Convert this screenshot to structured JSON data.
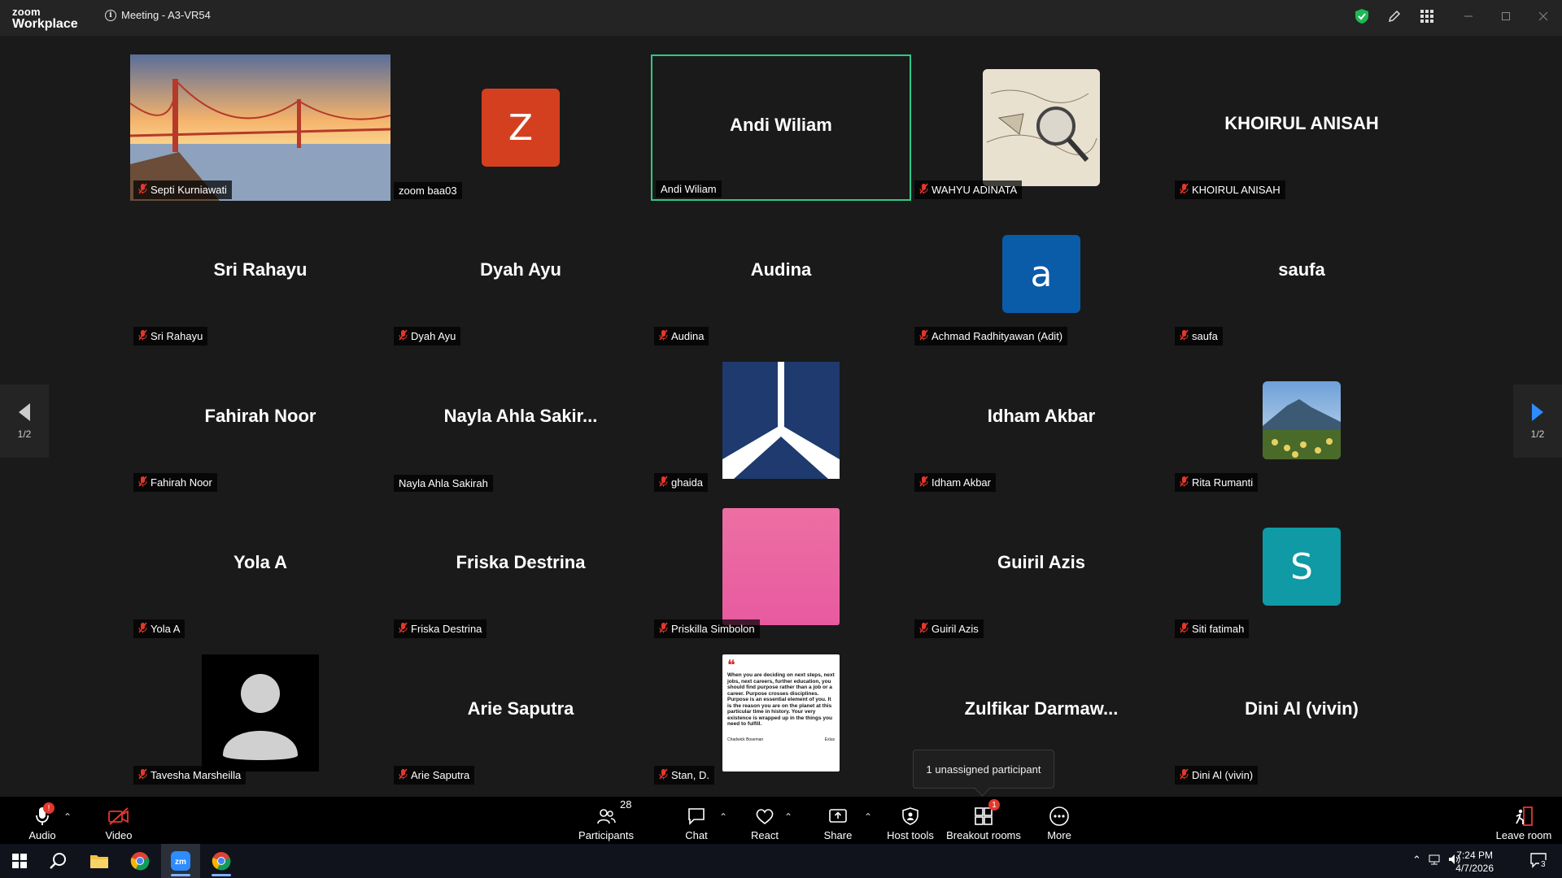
{
  "titlebar": {
    "brand_top": "zoom",
    "brand_bottom": "Workplace",
    "meeting_title": "Meeting - A3-VR54"
  },
  "colors": {
    "active_speaker": "#2dc98a",
    "muted": "#e5372c",
    "z_avatar": "#d4401f",
    "a_avatar": "#0a5ba8",
    "s_avatar": "#0f9aa5"
  },
  "navigation": {
    "prev_page": "1/2",
    "next_page": "1/2"
  },
  "tiles": [
    {
      "name": "Septi Kurniawati",
      "label": "Septi Kurniawati",
      "muted": true,
      "kind": "image-bridge"
    },
    {
      "name": "zoom baa03",
      "label": "zoom baa03",
      "muted": false,
      "kind": "letter",
      "letter": "Z"
    },
    {
      "name": "Andi Wiliam",
      "label": "Andi Wiliam",
      "muted": false,
      "kind": "name",
      "active": true
    },
    {
      "name": "WAHYU ADINATA",
      "label": "WAHYU ADINATA",
      "muted": true,
      "kind": "image-map"
    },
    {
      "name": "KHOIRUL ANISAH",
      "label": "KHOIRUL ANISAH",
      "muted": true,
      "kind": "name"
    },
    {
      "name": "Sri Rahayu",
      "label": "Sri Rahayu",
      "muted": true,
      "kind": "name"
    },
    {
      "name": "Dyah Ayu",
      "label": "Dyah Ayu",
      "muted": true,
      "kind": "name"
    },
    {
      "name": "Audina",
      "label": "Audina",
      "muted": true,
      "kind": "name"
    },
    {
      "name": "Achmad Radhityawan (Adit)",
      "label": "Achmad Radhityawan (Adit)",
      "muted": true,
      "kind": "letter",
      "letter": "a"
    },
    {
      "name": "saufa",
      "label": "saufa",
      "muted": true,
      "kind": "name"
    },
    {
      "name": "Fahirah Noor",
      "label": "Fahirah Noor",
      "muted": true,
      "kind": "name"
    },
    {
      "name": "Nayla Ahla Sakir...",
      "label": "Nayla Ahla Sakirah",
      "muted": false,
      "kind": "name"
    },
    {
      "name": "ghaida",
      "label": "ghaida",
      "muted": true,
      "kind": "image-logo"
    },
    {
      "name": "Idham Akbar",
      "label": "Idham Akbar",
      "muted": true,
      "kind": "name"
    },
    {
      "name": "Rita Rumanti",
      "label": "Rita Rumanti",
      "muted": true,
      "kind": "image-mountain"
    },
    {
      "name": "Yola A",
      "label": "Yola A",
      "muted": true,
      "kind": "name"
    },
    {
      "name": "Friska Destrina",
      "label": "Friska Destrina",
      "muted": true,
      "kind": "name"
    },
    {
      "name": "Priskilla Simbolon",
      "label": "Priskilla Simbolon",
      "muted": true,
      "kind": "image-pink"
    },
    {
      "name": "Guiril Azis",
      "label": "Guiril Azis",
      "muted": true,
      "kind": "name"
    },
    {
      "name": "Siti fatimah",
      "label": "Siti fatimah",
      "muted": true,
      "kind": "letter",
      "letter": "S"
    },
    {
      "name": "Tavesha Marsheilla",
      "label": "Tavesha Marsheilla",
      "muted": true,
      "kind": "image-person"
    },
    {
      "name": "Arie Saputra",
      "label": "Arie Saputra",
      "muted": true,
      "kind": "name"
    },
    {
      "name": "Stan, D.",
      "label": "Stan, D.",
      "muted": true,
      "kind": "image-quote"
    },
    {
      "name": "Zulfikar  Darmaw...",
      "label": "",
      "muted": false,
      "kind": "name"
    },
    {
      "name": "Dini Al (vivin)",
      "label": "Dini Al (vivin)",
      "muted": true,
      "kind": "name"
    }
  ],
  "quote": {
    "mark": "❝",
    "text": "When you are deciding on next steps, next jobs, next careers, further education, you should find purpose rather than a job or a career. Purpose crosses disciplines. Purpose is an essential element of you. It is the reason you are on the planet at this particular time in history. Your very existence is wrapped up in the things you need to fulfill.",
    "author": "Chadwick Boseman",
    "brand": "Exlus"
  },
  "tooltip": "1 unassigned participant",
  "toolbar": {
    "audio": "Audio",
    "video": "Video",
    "participants": "Participants",
    "participants_count": "28",
    "chat": "Chat",
    "react": "React",
    "share": "Share",
    "host_tools": "Host tools",
    "breakout_rooms": "Breakout rooms",
    "breakout_badge": "1",
    "audio_badge": "!",
    "more": "More",
    "leave": "Leave room"
  },
  "taskbar": {
    "time": "7:24 PM",
    "date": "4/7/2026",
    "notifications": "3"
  }
}
